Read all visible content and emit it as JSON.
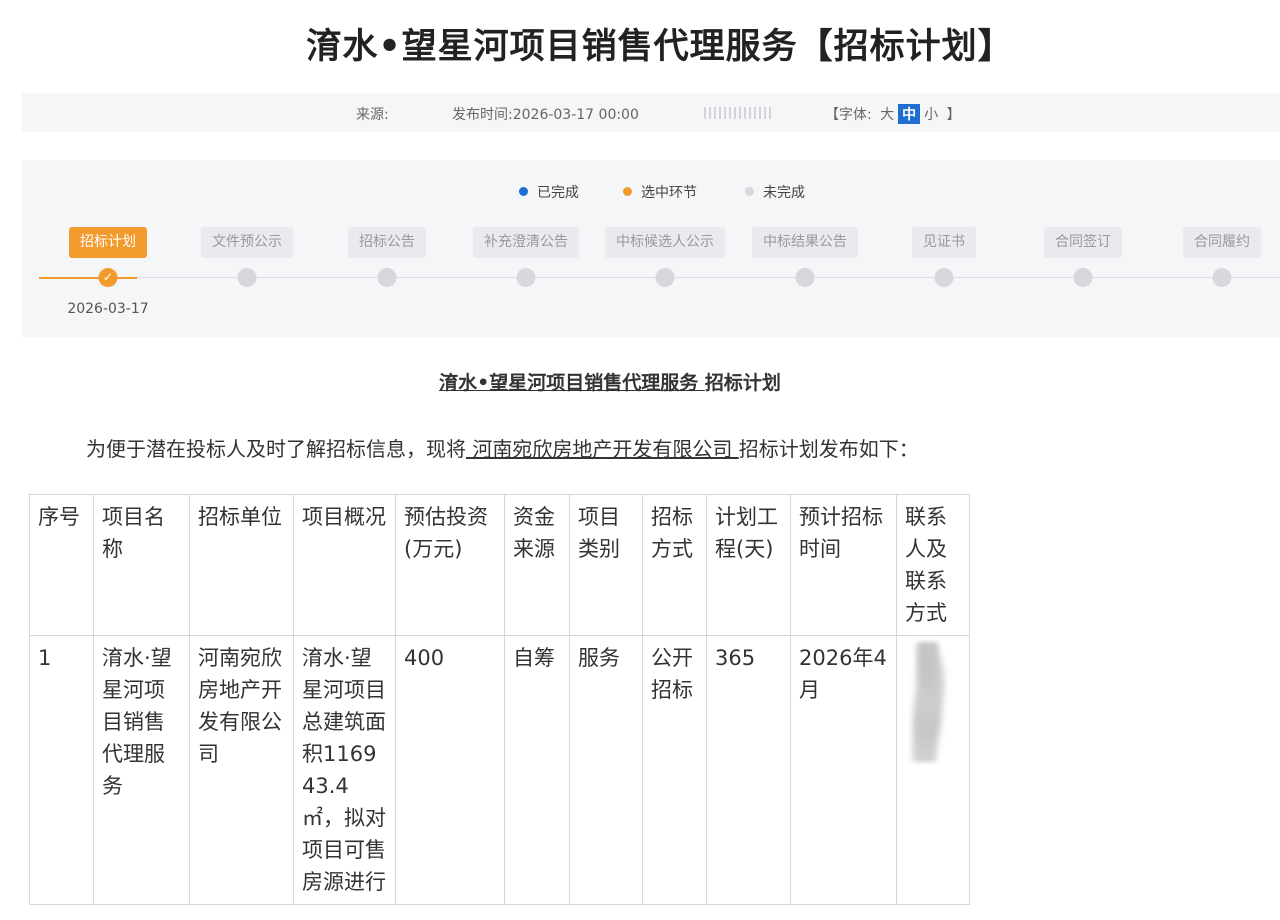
{
  "page": {
    "title": "淯水•望星河项目销售代理服务【招标计划】"
  },
  "meta": {
    "source_label": "来源:",
    "publish_label": "发布时间:",
    "publish_time": "2026-03-17 00:00",
    "font_label_open": "【字体:",
    "font_sizes": [
      "大",
      "中",
      "小"
    ],
    "font_label_close": "】"
  },
  "legend": {
    "done": "已完成",
    "selected": "选中环节",
    "todo": "未完成",
    "colors": {
      "done": "#1f6fd1",
      "selected": "#f39a2c",
      "todo": "#d6d8db"
    }
  },
  "steps": [
    {
      "label": "招标计划",
      "state": "selected",
      "date": "2026-03-17"
    },
    {
      "label": "文件预公示",
      "state": "todo",
      "date": ""
    },
    {
      "label": "招标公告",
      "state": "todo",
      "date": ""
    },
    {
      "label": "补充澄清公告",
      "state": "todo",
      "date": ""
    },
    {
      "label": "中标候选人公示",
      "state": "todo",
      "date": ""
    },
    {
      "label": "中标结果公告",
      "state": "todo",
      "date": ""
    },
    {
      "label": "见证书",
      "state": "todo",
      "date": ""
    },
    {
      "label": "合同签订",
      "state": "todo",
      "date": ""
    },
    {
      "label": "合同履约",
      "state": "todo",
      "date": ""
    }
  ],
  "document": {
    "heading_project": " 淯水•望星河项目销售代理服务 ",
    "heading_suffix": " 招标计划",
    "intro_prefix": "为便于潜在投标人及时了解招标信息，现将",
    "intro_company": " 河南宛欣房地产开发有限公司 ",
    "intro_suffix": "招标计划发布如下："
  },
  "table": {
    "headers": [
      "序号",
      "项目名称",
      "招标单位",
      "项目概况",
      "预估投资(万元)",
      "资金来源",
      "项目类别",
      "招标方式",
      "计划工程(天)",
      "预计招标时间",
      "联系人及联系方式"
    ],
    "rows": [
      [
        "1",
        "淯水·望星河项目销售代理服务",
        "河南宛欣房地产开发有限公司",
        " 淯水·望星河项目总建筑面积116943.4㎡，拟对项目可售房源进行",
        " 400",
        " 自筹",
        "服务",
        "公开招标",
        "365",
        " 2026年4月",
        ""
      ]
    ]
  }
}
